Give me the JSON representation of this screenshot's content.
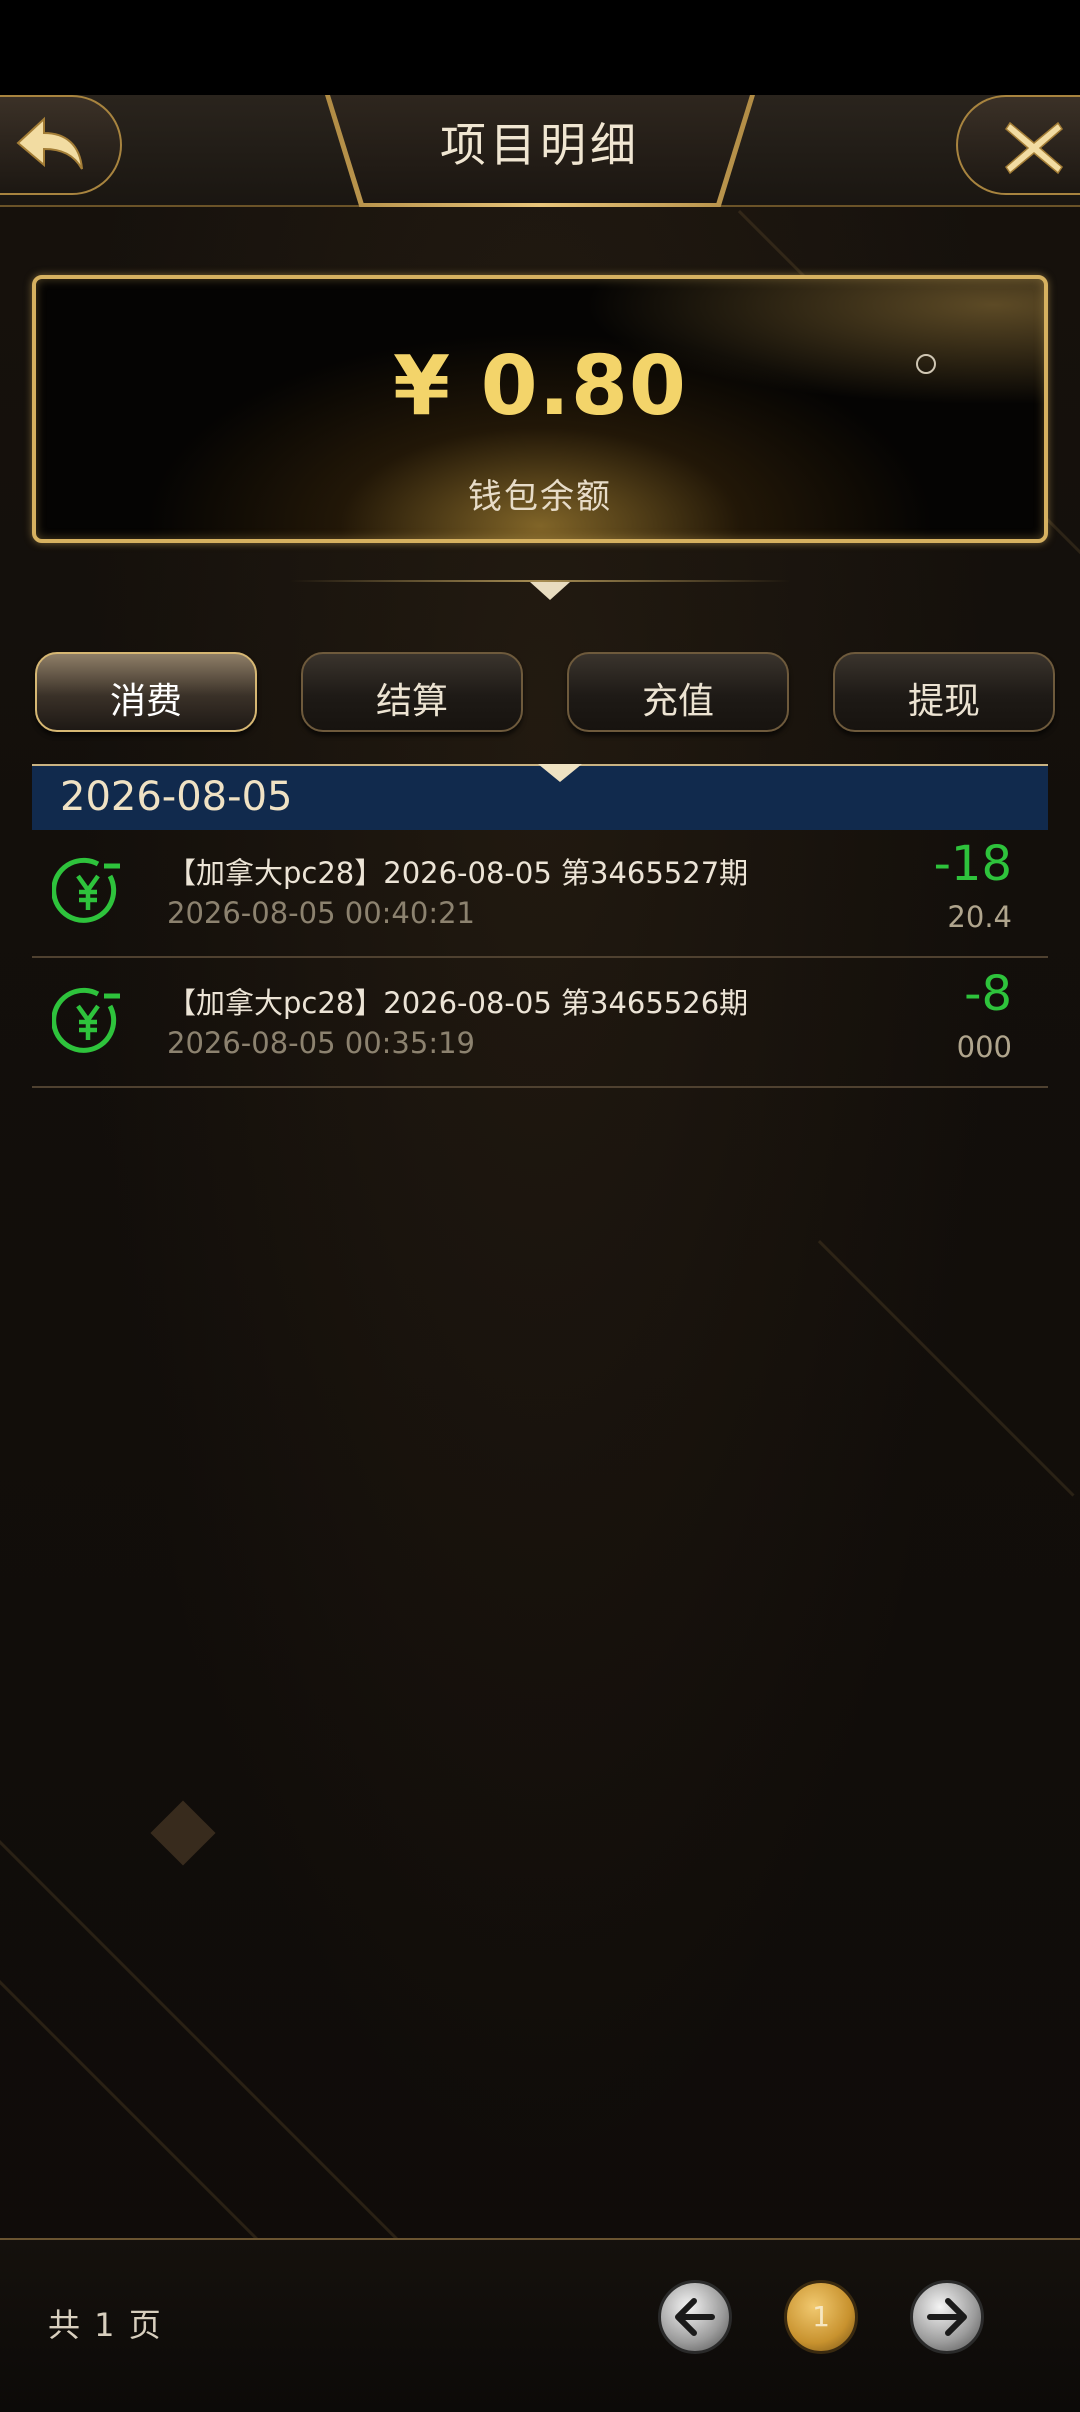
{
  "header": {
    "title": "项目明细"
  },
  "balance": {
    "amount": "¥ 0.80",
    "label": "钱包余额"
  },
  "tabs": [
    {
      "label": "消费",
      "active": true
    },
    {
      "label": "结算",
      "active": false
    },
    {
      "label": "充值",
      "active": false
    },
    {
      "label": "提现",
      "active": false
    }
  ],
  "date_group": "2026-08-05",
  "records": [
    {
      "title": "【加拿大pc28】2026-08-05 第3465527期",
      "time": "2026-08-05 00:40:21",
      "amount": "-18",
      "balance": "20.4"
    },
    {
      "title": "【加拿大pc28】2026-08-05 第3465526期",
      "time": "2026-08-05 00:35:19",
      "amount": "-8",
      "balance": "000"
    }
  ],
  "pagination": {
    "info": "共 1 页",
    "current": "1"
  },
  "colors": {
    "accent_gold": "#d6b160",
    "amount_gold": "#f3d46a",
    "negative_green": "#2ec33c",
    "date_bar": "#112a4d"
  },
  "icons": {
    "back": "back-arrow-icon",
    "close": "close-icon",
    "record": "yen-refund-icon",
    "prev": "arrow-left-icon",
    "next": "arrow-right-icon"
  }
}
